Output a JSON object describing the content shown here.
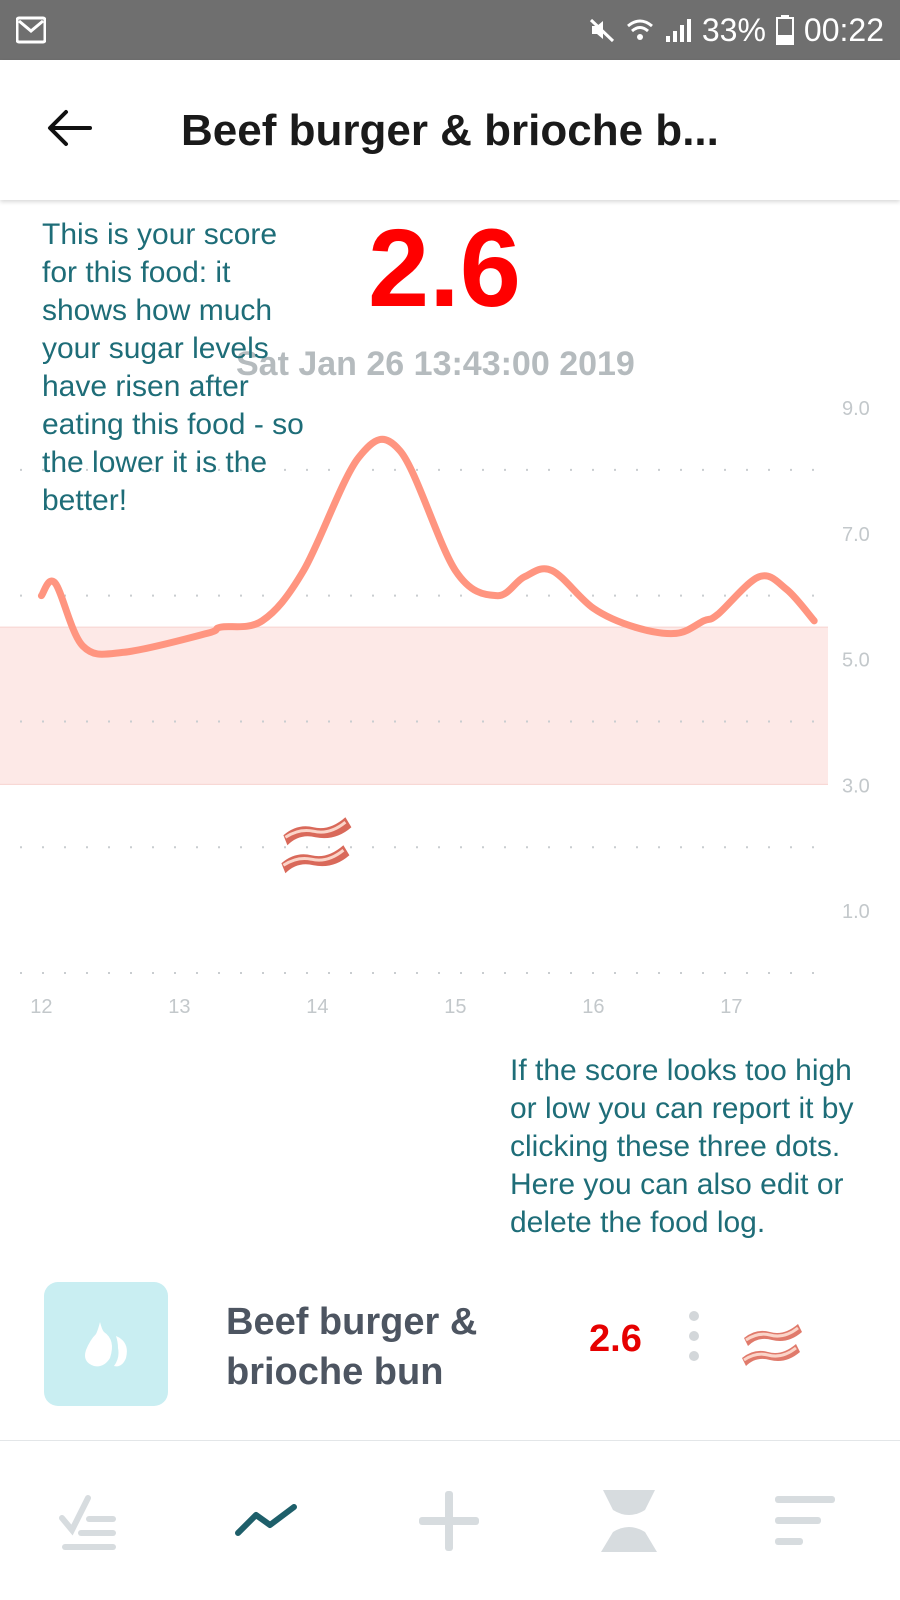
{
  "status_bar": {
    "battery": "33%",
    "time": "00:22",
    "icons": [
      "mail-icon",
      "mute-icon",
      "wifi-icon",
      "signal-icon",
      "battery-icon"
    ]
  },
  "header": {
    "title": "Beef burger & brioche b..."
  },
  "score": {
    "value": "2.6",
    "date": "Sat Jan 26 13:43:00 2019"
  },
  "annotations": {
    "score_note": "This is your score for this food: it shows how much your sugar levels have risen after eating this food - so the lower it is the better!",
    "dots_note": "If the score looks too high or low you can report it by clicking these three dots. Here you can also edit or delete the food log."
  },
  "chart_data": {
    "type": "line",
    "x": [
      12.0,
      12.1,
      12.3,
      12.6,
      13.2,
      13.3,
      13.6,
      13.9,
      14.3,
      14.6,
      15.0,
      15.3,
      15.5,
      15.7,
      16.0,
      16.3,
      16.6,
      16.8,
      16.9,
      17.2,
      17.4,
      17.6
    ],
    "y": [
      6.0,
      6.2,
      5.2,
      5.1,
      5.4,
      5.5,
      5.6,
      6.4,
      8.2,
      8.3,
      6.4,
      6.0,
      6.3,
      6.4,
      5.8,
      5.5,
      5.4,
      5.6,
      5.7,
      6.3,
      6.1,
      5.6
    ],
    "xticks": [
      "12",
      "13",
      "14",
      "15",
      "16",
      "17"
    ],
    "yticks": [
      "9.0",
      "7.0",
      "5.0",
      "3.0",
      "1.0"
    ],
    "xlim": [
      11.7,
      17.7
    ],
    "ylim": [
      0.0,
      9.0
    ],
    "target_band": [
      3.0,
      5.5
    ],
    "meal_marker": {
      "x": 14.0,
      "y": 2.0,
      "icon": "bacon-icon"
    },
    "grid": "dotted horizontal",
    "colors": {
      "line": "#ff9580",
      "band": "#fde9e7"
    }
  },
  "food_log": {
    "name": "Beef burger & brioche bun",
    "score": "2.6",
    "thumb_icon": "pear-icon",
    "emoji_icon": "bacon-icon",
    "more_icon": "three-dots-icon"
  },
  "bottom_nav": {
    "items": [
      {
        "icon": "checklist-icon",
        "active": false
      },
      {
        "icon": "trend-icon",
        "active": true
      },
      {
        "icon": "plus-icon",
        "active": false
      },
      {
        "icon": "hourglass-icon",
        "active": false
      },
      {
        "icon": "menu-icon",
        "active": false
      }
    ]
  },
  "colors": {
    "score_red": "#ff0000",
    "annotation_teal": "#1e6d78",
    "statusbar_gray": "#6f6f6f"
  }
}
